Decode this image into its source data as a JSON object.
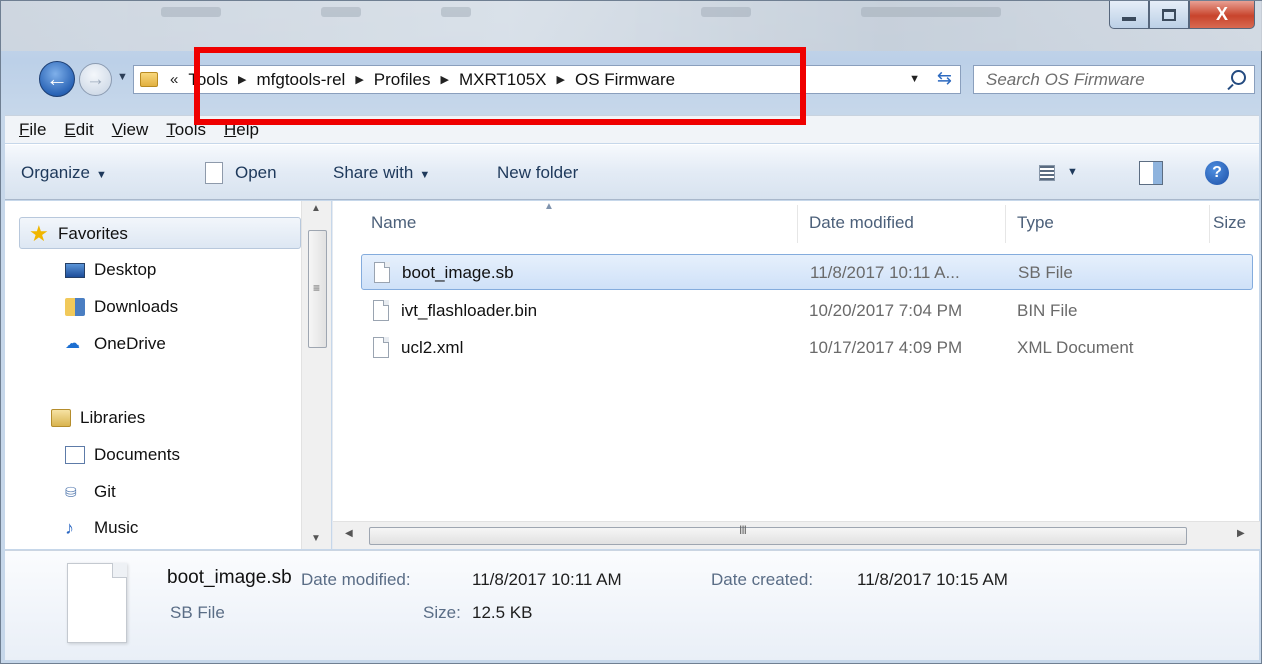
{
  "window": {
    "controls": {
      "close_label": "X"
    }
  },
  "address_bar": {
    "overflow": "«",
    "breadcrumbs": [
      "Tools",
      "mfgtools-rel",
      "Profiles",
      "MXRT105X",
      "OS Firmware"
    ]
  },
  "search": {
    "placeholder": "Search OS Firmware"
  },
  "menu": [
    "File",
    "Edit",
    "View",
    "Tools",
    "Help"
  ],
  "toolbar": {
    "organize": "Organize",
    "open": "Open",
    "share_with": "Share with",
    "new_folder": "New folder"
  },
  "nav_pane": {
    "favorites": {
      "label": "Favorites",
      "items": [
        "Desktop",
        "Downloads",
        "OneDrive"
      ]
    },
    "libraries": {
      "label": "Libraries",
      "items": [
        "Documents",
        "Git",
        "Music"
      ]
    }
  },
  "file_list": {
    "columns": [
      "Name",
      "Date modified",
      "Type",
      "Size"
    ],
    "rows": [
      {
        "name": "boot_image.sb",
        "date": "11/8/2017 10:11 A...",
        "type": "SB File",
        "selected": true
      },
      {
        "name": "ivt_flashloader.bin",
        "date": "10/20/2017 7:04 PM",
        "type": "BIN File",
        "selected": false
      },
      {
        "name": "ucl2.xml",
        "date": "10/17/2017 4:09 PM",
        "type": "XML Document",
        "selected": false
      }
    ]
  },
  "details": {
    "file_name": "boot_image.sb",
    "file_type": "SB File",
    "date_modified_label": "Date modified:",
    "date_modified": "11/8/2017 10:11 AM",
    "date_created_label": "Date created:",
    "date_created": "11/8/2017 10:15 AM",
    "size_label": "Size:",
    "size": "12.5 KB"
  },
  "scroll": {
    "grip": "III"
  },
  "colors": {
    "highlight": "#ef0000",
    "selection": "#cfe1f8",
    "accent": "#1e395b"
  }
}
